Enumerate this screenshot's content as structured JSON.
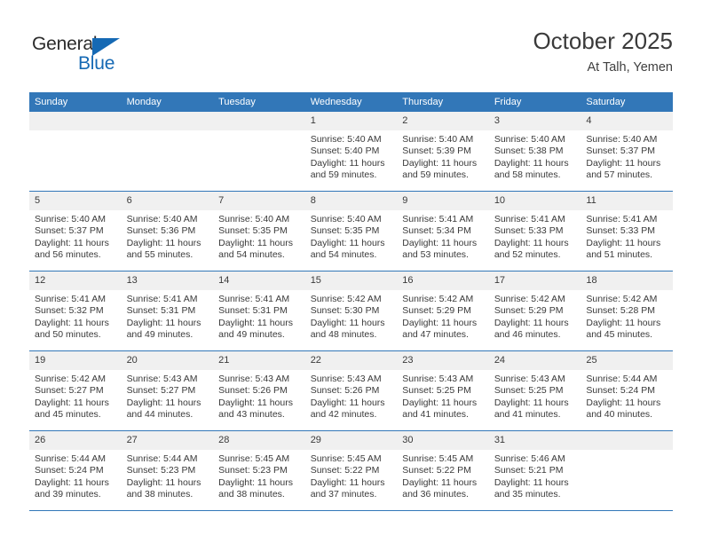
{
  "logo": {
    "word_top": "General",
    "word_bottom": "Blue",
    "brand_color": "#1569b4",
    "triangle_icon": "triangle-icon"
  },
  "header": {
    "month_title": "October 2025",
    "location": "At Talh, Yemen"
  },
  "colors": {
    "header_band": "#3277b8",
    "daynum_strip": "#f0f0f0",
    "week_divider": "#3277b8",
    "text": "#3a3a3a"
  },
  "weekday_headers": [
    "Sunday",
    "Monday",
    "Tuesday",
    "Wednesday",
    "Thursday",
    "Friday",
    "Saturday"
  ],
  "weeks": [
    [
      {
        "day": "",
        "empty": true
      },
      {
        "day": "",
        "empty": true
      },
      {
        "day": "",
        "empty": true
      },
      {
        "day": "1",
        "sunrise": "Sunrise: 5:40 AM",
        "sunset": "Sunset: 5:40 PM",
        "daylight": "Daylight: 11 hours and 59 minutes."
      },
      {
        "day": "2",
        "sunrise": "Sunrise: 5:40 AM",
        "sunset": "Sunset: 5:39 PM",
        "daylight": "Daylight: 11 hours and 59 minutes."
      },
      {
        "day": "3",
        "sunrise": "Sunrise: 5:40 AM",
        "sunset": "Sunset: 5:38 PM",
        "daylight": "Daylight: 11 hours and 58 minutes."
      },
      {
        "day": "4",
        "sunrise": "Sunrise: 5:40 AM",
        "sunset": "Sunset: 5:37 PM",
        "daylight": "Daylight: 11 hours and 57 minutes."
      }
    ],
    [
      {
        "day": "5",
        "sunrise": "Sunrise: 5:40 AM",
        "sunset": "Sunset: 5:37 PM",
        "daylight": "Daylight: 11 hours and 56 minutes."
      },
      {
        "day": "6",
        "sunrise": "Sunrise: 5:40 AM",
        "sunset": "Sunset: 5:36 PM",
        "daylight": "Daylight: 11 hours and 55 minutes."
      },
      {
        "day": "7",
        "sunrise": "Sunrise: 5:40 AM",
        "sunset": "Sunset: 5:35 PM",
        "daylight": "Daylight: 11 hours and 54 minutes."
      },
      {
        "day": "8",
        "sunrise": "Sunrise: 5:40 AM",
        "sunset": "Sunset: 5:35 PM",
        "daylight": "Daylight: 11 hours and 54 minutes."
      },
      {
        "day": "9",
        "sunrise": "Sunrise: 5:41 AM",
        "sunset": "Sunset: 5:34 PM",
        "daylight": "Daylight: 11 hours and 53 minutes."
      },
      {
        "day": "10",
        "sunrise": "Sunrise: 5:41 AM",
        "sunset": "Sunset: 5:33 PM",
        "daylight": "Daylight: 11 hours and 52 minutes."
      },
      {
        "day": "11",
        "sunrise": "Sunrise: 5:41 AM",
        "sunset": "Sunset: 5:33 PM",
        "daylight": "Daylight: 11 hours and 51 minutes."
      }
    ],
    [
      {
        "day": "12",
        "sunrise": "Sunrise: 5:41 AM",
        "sunset": "Sunset: 5:32 PM",
        "daylight": "Daylight: 11 hours and 50 minutes."
      },
      {
        "day": "13",
        "sunrise": "Sunrise: 5:41 AM",
        "sunset": "Sunset: 5:31 PM",
        "daylight": "Daylight: 11 hours and 49 minutes."
      },
      {
        "day": "14",
        "sunrise": "Sunrise: 5:41 AM",
        "sunset": "Sunset: 5:31 PM",
        "daylight": "Daylight: 11 hours and 49 minutes."
      },
      {
        "day": "15",
        "sunrise": "Sunrise: 5:42 AM",
        "sunset": "Sunset: 5:30 PM",
        "daylight": "Daylight: 11 hours and 48 minutes."
      },
      {
        "day": "16",
        "sunrise": "Sunrise: 5:42 AM",
        "sunset": "Sunset: 5:29 PM",
        "daylight": "Daylight: 11 hours and 47 minutes."
      },
      {
        "day": "17",
        "sunrise": "Sunrise: 5:42 AM",
        "sunset": "Sunset: 5:29 PM",
        "daylight": "Daylight: 11 hours and 46 minutes."
      },
      {
        "day": "18",
        "sunrise": "Sunrise: 5:42 AM",
        "sunset": "Sunset: 5:28 PM",
        "daylight": "Daylight: 11 hours and 45 minutes."
      }
    ],
    [
      {
        "day": "19",
        "sunrise": "Sunrise: 5:42 AM",
        "sunset": "Sunset: 5:27 PM",
        "daylight": "Daylight: 11 hours and 45 minutes."
      },
      {
        "day": "20",
        "sunrise": "Sunrise: 5:43 AM",
        "sunset": "Sunset: 5:27 PM",
        "daylight": "Daylight: 11 hours and 44 minutes."
      },
      {
        "day": "21",
        "sunrise": "Sunrise: 5:43 AM",
        "sunset": "Sunset: 5:26 PM",
        "daylight": "Daylight: 11 hours and 43 minutes."
      },
      {
        "day": "22",
        "sunrise": "Sunrise: 5:43 AM",
        "sunset": "Sunset: 5:26 PM",
        "daylight": "Daylight: 11 hours and 42 minutes."
      },
      {
        "day": "23",
        "sunrise": "Sunrise: 5:43 AM",
        "sunset": "Sunset: 5:25 PM",
        "daylight": "Daylight: 11 hours and 41 minutes."
      },
      {
        "day": "24",
        "sunrise": "Sunrise: 5:43 AM",
        "sunset": "Sunset: 5:25 PM",
        "daylight": "Daylight: 11 hours and 41 minutes."
      },
      {
        "day": "25",
        "sunrise": "Sunrise: 5:44 AM",
        "sunset": "Sunset: 5:24 PM",
        "daylight": "Daylight: 11 hours and 40 minutes."
      }
    ],
    [
      {
        "day": "26",
        "sunrise": "Sunrise: 5:44 AM",
        "sunset": "Sunset: 5:24 PM",
        "daylight": "Daylight: 11 hours and 39 minutes."
      },
      {
        "day": "27",
        "sunrise": "Sunrise: 5:44 AM",
        "sunset": "Sunset: 5:23 PM",
        "daylight": "Daylight: 11 hours and 38 minutes."
      },
      {
        "day": "28",
        "sunrise": "Sunrise: 5:45 AM",
        "sunset": "Sunset: 5:23 PM",
        "daylight": "Daylight: 11 hours and 38 minutes."
      },
      {
        "day": "29",
        "sunrise": "Sunrise: 5:45 AM",
        "sunset": "Sunset: 5:22 PM",
        "daylight": "Daylight: 11 hours and 37 minutes."
      },
      {
        "day": "30",
        "sunrise": "Sunrise: 5:45 AM",
        "sunset": "Sunset: 5:22 PM",
        "daylight": "Daylight: 11 hours and 36 minutes."
      },
      {
        "day": "31",
        "sunrise": "Sunrise: 5:46 AM",
        "sunset": "Sunset: 5:21 PM",
        "daylight": "Daylight: 11 hours and 35 minutes."
      },
      {
        "day": "",
        "empty": true
      }
    ]
  ]
}
